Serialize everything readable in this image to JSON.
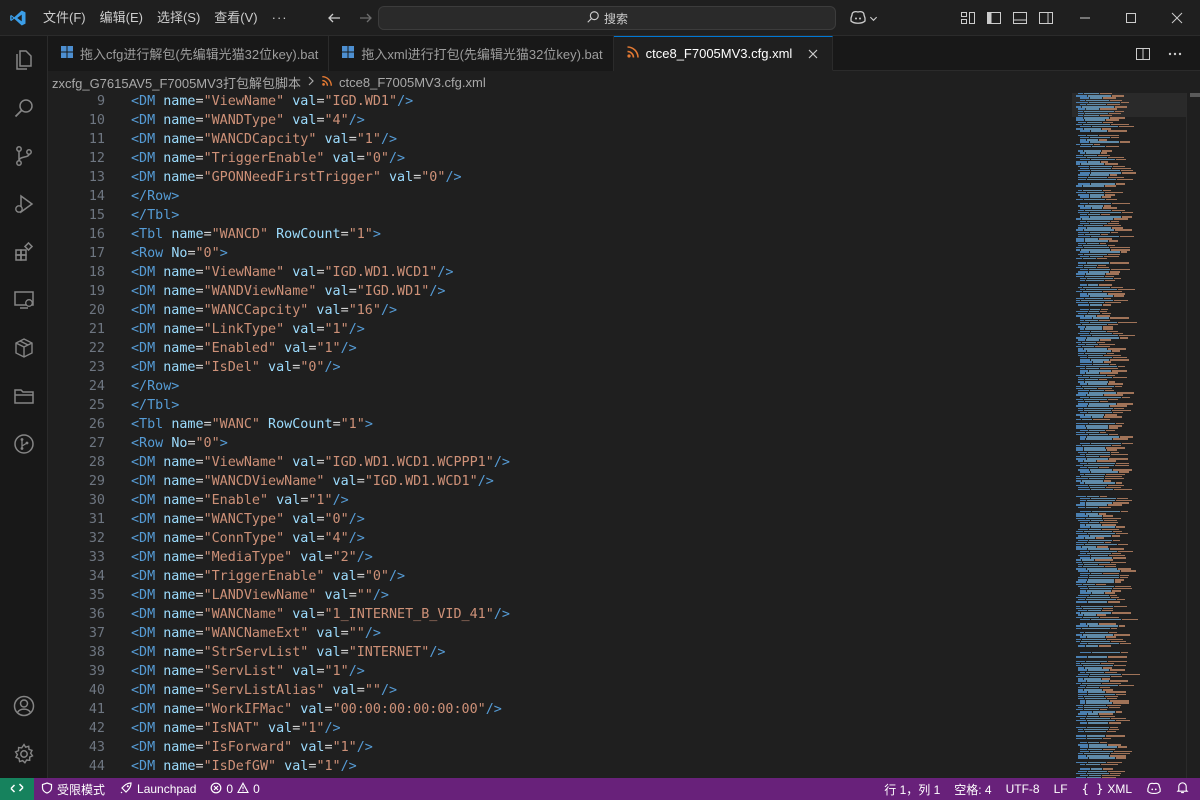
{
  "menu": [
    "文件(F)",
    "编辑(E)",
    "选择(S)",
    "查看(V)",
    "···"
  ],
  "command_center": {
    "label": "搜索"
  },
  "tabs": [
    {
      "label": "拖入cfg进行解包(先编辑光猫32位key).bat",
      "icon": "windows-bat-icon",
      "active": false
    },
    {
      "label": "拖入xml进行打包(先编辑光猫32位key).bat",
      "icon": "windows-bat-icon",
      "active": false
    },
    {
      "label": "ctce8_F7005MV3.cfg.xml",
      "icon": "xml-rss-icon",
      "active": true
    }
  ],
  "breadcrumb": {
    "folder": "zxcfg_G7615AV5_F7005MV3打包解包脚本",
    "file": "ctce8_F7005MV3.cfg.xml"
  },
  "lines": [
    {
      "n": "9",
      "indent": 0,
      "kind": "dm",
      "name": "ViewName",
      "val": "IGD.WD1"
    },
    {
      "n": "10",
      "kind": "dm",
      "name": "WANDType",
      "val": "4"
    },
    {
      "n": "11",
      "kind": "dm",
      "name": "WANCDCapcity",
      "val": "1"
    },
    {
      "n": "12",
      "kind": "dm",
      "name": "TriggerEnable",
      "val": "0"
    },
    {
      "n": "13",
      "kind": "dm",
      "name": "GPONNeedFirstTrigger",
      "val": "0"
    },
    {
      "n": "14",
      "kind": "close",
      "tag": "Row"
    },
    {
      "n": "15",
      "kind": "close",
      "tag": "Tbl"
    },
    {
      "n": "16",
      "kind": "tbl",
      "name": "WANCD",
      "rowcount": "1"
    },
    {
      "n": "17",
      "kind": "row",
      "no": "0"
    },
    {
      "n": "18",
      "kind": "dm",
      "name": "ViewName",
      "val": "IGD.WD1.WCD1"
    },
    {
      "n": "19",
      "kind": "dm",
      "name": "WANDViewName",
      "val": "IGD.WD1"
    },
    {
      "n": "20",
      "kind": "dm",
      "name": "WANCCapcity",
      "val": "16"
    },
    {
      "n": "21",
      "kind": "dm",
      "name": "LinkType",
      "val": "1"
    },
    {
      "n": "22",
      "kind": "dm",
      "name": "Enabled",
      "val": "1"
    },
    {
      "n": "23",
      "kind": "dm",
      "name": "IsDel",
      "val": "0"
    },
    {
      "n": "24",
      "kind": "close",
      "tag": "Row"
    },
    {
      "n": "25",
      "kind": "close",
      "tag": "Tbl"
    },
    {
      "n": "26",
      "kind": "tbl",
      "name": "WANC",
      "rowcount": "1"
    },
    {
      "n": "27",
      "kind": "row",
      "no": "0"
    },
    {
      "n": "28",
      "kind": "dm",
      "name": "ViewName",
      "val": "IGD.WD1.WCD1.WCPPP1"
    },
    {
      "n": "29",
      "kind": "dm",
      "name": "WANCDViewName",
      "val": "IGD.WD1.WCD1"
    },
    {
      "n": "30",
      "kind": "dm",
      "name": "Enable",
      "val": "1"
    },
    {
      "n": "31",
      "kind": "dm",
      "name": "WANCType",
      "val": "0"
    },
    {
      "n": "32",
      "kind": "dm",
      "name": "ConnType",
      "val": "4"
    },
    {
      "n": "33",
      "kind": "dm",
      "name": "MediaType",
      "val": "2"
    },
    {
      "n": "34",
      "kind": "dm",
      "name": "TriggerEnable",
      "val": "0"
    },
    {
      "n": "35",
      "kind": "dm",
      "name": "LANDViewName",
      "val": ""
    },
    {
      "n": "36",
      "kind": "dm",
      "name": "WANCName",
      "val": "1_INTERNET_B_VID_41"
    },
    {
      "n": "37",
      "kind": "dm",
      "name": "WANCNameExt",
      "val": ""
    },
    {
      "n": "38",
      "kind": "dm",
      "name": "StrServList",
      "val": "INTERNET"
    },
    {
      "n": "39",
      "kind": "dm",
      "name": "ServList",
      "val": "1"
    },
    {
      "n": "40",
      "kind": "dm",
      "name": "ServListAlias",
      "val": ""
    },
    {
      "n": "41",
      "kind": "dm",
      "name": "WorkIFMac",
      "val": "00:00:00:00:00:00"
    },
    {
      "n": "42",
      "kind": "dm",
      "name": "IsNAT",
      "val": "1"
    },
    {
      "n": "43",
      "kind": "dm",
      "name": "IsForward",
      "val": "1"
    },
    {
      "n": "44",
      "kind": "dm",
      "name": "IsDefGW",
      "val": "1"
    }
  ],
  "statusbar": {
    "restricted_mode": "受限模式",
    "launchpad": "Launchpad",
    "errors": "0",
    "warnings": "0",
    "position": "行 1，列 1",
    "spaces": "空格: 4",
    "encoding": "UTF-8",
    "eol": "LF",
    "language": "XML"
  },
  "colors": {
    "status_bar": "#68217a",
    "remote_indicator": "#16825d",
    "active_tab_border": "#0078d4",
    "xml_tag": "#569cd6",
    "xml_attr": "#9cdcfe",
    "xml_value": "#ce9178"
  }
}
